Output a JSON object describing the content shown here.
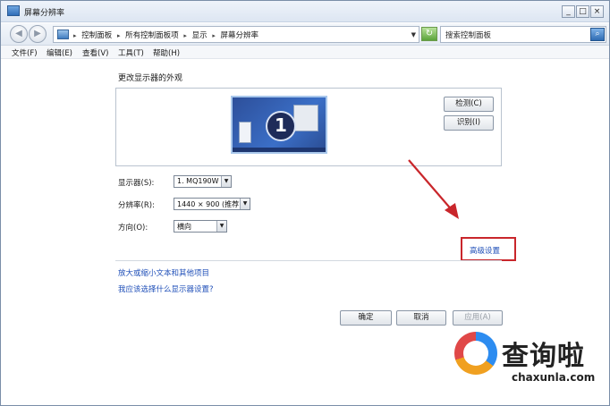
{
  "window": {
    "title": "屏幕分辨率",
    "minimize": "_",
    "maximize": "□",
    "close": "×"
  },
  "nav": {
    "back_icon": "◀",
    "forward_icon": "▶",
    "breadcrumbs": [
      "控制面板",
      "所有控制面板项",
      "显示",
      "屏幕分辨率"
    ],
    "breadcrumb_sep": "▸",
    "dropdown_icon": "▼",
    "refresh_icon": "↻",
    "search_placeholder": "搜索控制面板",
    "search_icon": "⌕"
  },
  "menu": {
    "items": [
      "文件(F)",
      "编辑(E)",
      "查看(V)",
      "工具(T)",
      "帮助(H)"
    ]
  },
  "main": {
    "heading": "更改显示器的外观",
    "monitor_number": "1",
    "detect_button": "检测(C)",
    "identify_button": "识别(I)",
    "display": {
      "label": "显示器(S):",
      "value": "1. MQ190W"
    },
    "resolution": {
      "label": "分辨率(R):",
      "value": "1440 × 900 (推荐)"
    },
    "orientation": {
      "label": "方向(O):",
      "value": "横向"
    },
    "advanced_link": "高级设置",
    "links": [
      "放大或缩小文本和其他项目",
      "我应该选择什么显示器设置?"
    ],
    "ok_button": "确定",
    "cancel_button": "取消",
    "apply_button": "应用(A)"
  },
  "colors": {
    "link": "#1f4fb8",
    "highlight_box": "#c9262b",
    "annotation_arrow": "#c9262b"
  },
  "watermark": {
    "title": "查询啦",
    "url": "chaxunla.com"
  }
}
